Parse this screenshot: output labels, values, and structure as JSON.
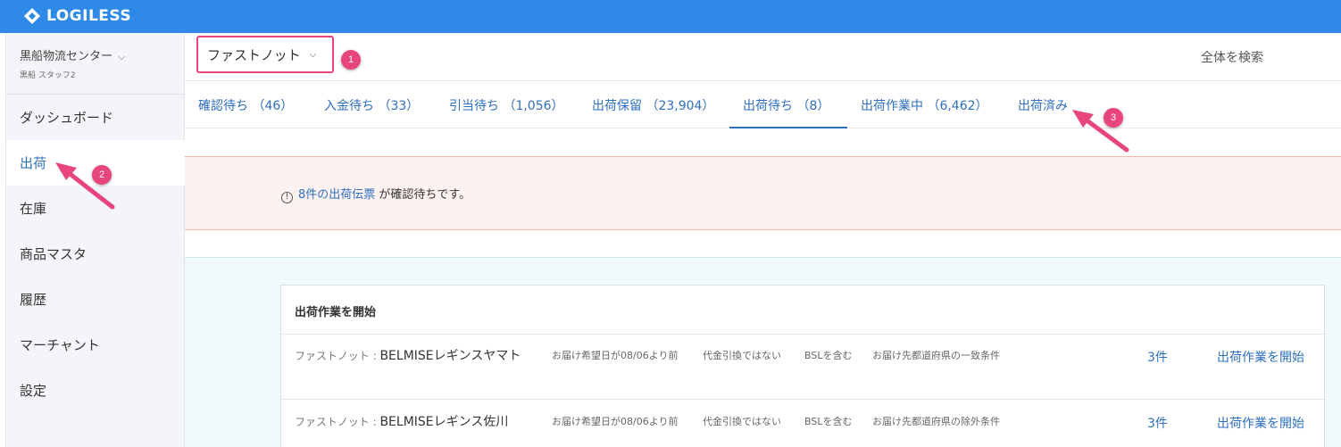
{
  "app": {
    "brand": "LOGILESS"
  },
  "sidebar": {
    "org_name": "黒船物流センター",
    "staff_name": "黒船 スタッフ2",
    "items": [
      {
        "label": "ダッシュボード"
      },
      {
        "label": "出荷"
      },
      {
        "label": "在庫"
      },
      {
        "label": "商品マスタ"
      },
      {
        "label": "履歴"
      },
      {
        "label": "マーチャント"
      },
      {
        "label": "設定"
      }
    ]
  },
  "header": {
    "store_select": "ファストノット",
    "search_all": "全体を検索"
  },
  "tabs": [
    {
      "label": "確認待ち （46）"
    },
    {
      "label": "入金待ち （33）"
    },
    {
      "label": "引当待ち （1,056）"
    },
    {
      "label": "出荷保留 （23,904）"
    },
    {
      "label": "出荷待ち （8）"
    },
    {
      "label": "出荷作業中 （6,462）"
    },
    {
      "label": "出荷済み"
    }
  ],
  "alert": {
    "icon": "info-icon",
    "link_text": "8件の出荷伝票",
    "suffix": " が確認待ちです。"
  },
  "card": {
    "title": "出荷作業を開始",
    "rows": [
      {
        "prefix": "ファストノット : ",
        "name": "BELMISEレギンスヤマト",
        "conditions": [
          "お届け希望日が08/06より前",
          "代金引換ではない",
          "BSLを含む",
          "お届け先都道府県の一致条件"
        ],
        "count": "3件",
        "action": "出荷作業を開始"
      },
      {
        "prefix": "ファストノット : ",
        "name": "BELMISEレギンス佐川",
        "conditions": [
          "お届け希望日が08/06より前",
          "代金引換ではない",
          "BSLを含む",
          "お届け先都道府県の除外条件"
        ],
        "count": "3件",
        "action": "出荷作業を開始"
      }
    ]
  },
  "annotations": {
    "badge1": "1",
    "badge2": "2",
    "badge3": "3",
    "color": "#e8457f"
  },
  "colors": {
    "brand": "#2f89e6",
    "link": "#2f6fc0",
    "accent": "#e8457f"
  }
}
